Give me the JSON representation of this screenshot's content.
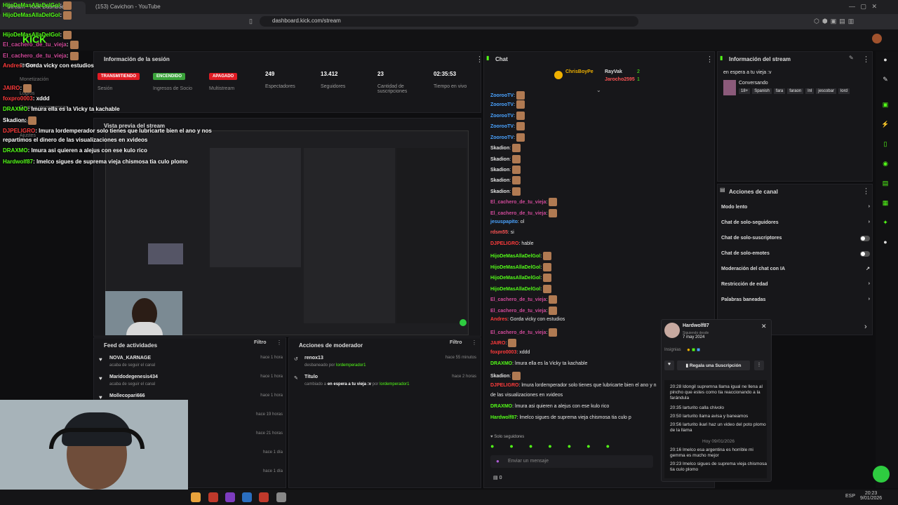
{
  "browser": {
    "tabs": [
      "Stream - Kick Dashboard",
      "(153) Cavichon - YouTube"
    ],
    "url": "dashboard.kick.com/stream"
  },
  "overlay_chat": [
    {
      "user": "HijoDeMasAllaDelGol",
      "text": ""
    },
    {
      "user": "HijoDeMasAllaDelGol",
      "text": ""
    },
    {
      "user": "El_cachero_de_tu_vieja",
      "text": ""
    },
    {
      "user": "El_cachero_de_tu_vieja",
      "text": ""
    },
    {
      "user": "Andres",
      "text": "Gorda vicky con estudios"
    },
    {
      "user": "JAIRO",
      "text": ""
    },
    {
      "user": "foxpro0003",
      "text": "xddd"
    },
    {
      "user": "DRAXMO",
      "text": "lmura ella es la Vicky ta kachable"
    },
    {
      "user": "Skadion",
      "text": ""
    },
    {
      "user": "DJPELIGRO",
      "text": "lmura lordemperador solo tienes que lubricarte bien el ano y nos"
    },
    {
      "user": "",
      "text": "repartimos el dinero de las visualizaciones en xvideos"
    },
    {
      "user": "DRAXMO",
      "text": "lmura asi quieren a alejus con ese kulo rico"
    },
    {
      "user": "Hardwolf87",
      "text": "lmelco sigues de suprema vieja chismosa tia culo plomo"
    }
  ],
  "left_nav": [
    "Stream",
    "Monetización",
    "Logros",
    "Grupo y recompensas",
    "Estudio",
    "Ajustes"
  ],
  "session": {
    "title": "Información de la sesión",
    "badges": [
      {
        "label": "TRANSMITIENDO",
        "color": "#e01b24",
        "caption": "Sesión"
      },
      {
        "label": "ENCENDIDO",
        "color": "#3aa33a",
        "caption": "Ingresos de Socio"
      },
      {
        "label": "APAGADO",
        "color": "#e01b24",
        "caption": "Multistream"
      }
    ],
    "stats": [
      {
        "value": "249",
        "label": "Espectadores"
      },
      {
        "value": "13.412",
        "label": "Seguidores"
      },
      {
        "value": "23",
        "label": "Cantidad de suscripciones"
      },
      {
        "value": "02:35:53",
        "label": "Tiempo en vivo"
      }
    ]
  },
  "preview": {
    "title": "Vista previa del stream"
  },
  "activity_feed": {
    "title": "Feed de actividades",
    "filter": "Filtro",
    "items": [
      {
        "name": "NOVA_KARNAGE",
        "sub": "acaba de seguir el canal",
        "time": "hace 1 hora"
      },
      {
        "name": "Maridodegenesis434",
        "sub": "acaba de seguir el canal",
        "time": "hace 1 hora"
      },
      {
        "name": "Mollecopari666",
        "sub": "",
        "time": "hace 1 hora"
      },
      {
        "name": "",
        "sub": "",
        "time": "hace 19 horas"
      },
      {
        "name": "",
        "sub": "",
        "time": "hace 21 horas"
      },
      {
        "name": "",
        "sub": "",
        "time": "hace 1 día"
      },
      {
        "name": "",
        "sub": "",
        "time": "hace 1 día"
      }
    ]
  },
  "mod_actions": {
    "title": "Acciones de moderador",
    "filter": "Filtro",
    "items": [
      {
        "name": "renox13",
        "sub1": "desbaneado por ",
        "mod": "lordemperador1",
        "time": "hace 55 minutos"
      },
      {
        "name": "Título",
        "sub1": "cambiado a ",
        "extra": "en espera a tu vieja :v",
        "sub2": " por ",
        "mod": "lordemperador1",
        "time": "hace 2 horas"
      }
    ]
  },
  "chat": {
    "title": "Chat",
    "top_users": [
      "ChrisBoyPe",
      "RayVak",
      "Jarocho2595"
    ],
    "top_counts": [
      "2",
      "1"
    ],
    "messages": [
      {
        "user": "ZoorooTV",
        "text": "",
        "color": "#4aa3ff"
      },
      {
        "user": "ZoorooTV",
        "text": "",
        "color": "#4aa3ff"
      },
      {
        "user": "ZoorooTV",
        "text": "",
        "color": "#4aa3ff"
      },
      {
        "user": "ZoorooTV",
        "text": "",
        "color": "#4aa3ff"
      },
      {
        "user": "ZoorooTV",
        "text": "",
        "color": "#4aa3ff"
      },
      {
        "user": "Skadion",
        "text": "",
        "color": "#e0e0e0"
      },
      {
        "user": "Skadion",
        "text": "",
        "color": "#e0e0e0"
      },
      {
        "user": "Skadion",
        "text": "",
        "color": "#e0e0e0"
      },
      {
        "user": "Skadion",
        "text": "",
        "color": "#e0e0e0"
      },
      {
        "user": "Skadion",
        "text": "",
        "color": "#e0e0e0"
      },
      {
        "user": "El_cachero_de_tu_vieja",
        "text": "",
        "color": "#d04a9a"
      },
      {
        "user": "El_cachero_de_tu_vieja",
        "text": "",
        "color": "#d04a9a"
      },
      {
        "user": "jesuspapito",
        "text": "ol",
        "color": "#4aa3ff"
      },
      {
        "user": "rdsm55",
        "text": "si",
        "color": "#ff5555"
      },
      {
        "user": "DJPELIGRO",
        "text": "hable",
        "color": "#ff3b3b"
      },
      {
        "user": "HijoDeMasAllaDelGol",
        "text": "",
        "color": "#53fc18"
      },
      {
        "user": "HijoDeMasAllaDelGol",
        "text": "",
        "color": "#53fc18"
      },
      {
        "user": "HijoDeMasAllaDelGol",
        "text": "",
        "color": "#53fc18"
      },
      {
        "user": "HijoDeMasAllaDelGol",
        "text": "",
        "color": "#53fc18"
      },
      {
        "user": "El_cachero_de_tu_vieja",
        "text": "",
        "color": "#d04a9a"
      },
      {
        "user": "El_cachero_de_tu_vieja",
        "text": "",
        "color": "#d04a9a"
      },
      {
        "user": "Andres",
        "text": "Gorda vicky con estudios",
        "color": "#ff3b3b"
      },
      {
        "user": "El_cachero_de_tu_vieja",
        "text": "",
        "color": "#d04a9a"
      },
      {
        "user": "JAIRO",
        "text": "",
        "color": "#ff3b3b"
      },
      {
        "user": "foxpro0003",
        "text": "xddd",
        "color": "#ff3b3b"
      },
      {
        "user": "DRAXMO",
        "text": "lmura ella es la Vicky ta kachable",
        "color": "#53fc18"
      },
      {
        "user": "Skadion",
        "text": "",
        "color": "#e0e0e0"
      },
      {
        "user": "DJPELIGRO",
        "text": "lmura lordemperador solo tienes que lubricarte bien el ano y n",
        "color": "#ff3b3b"
      },
      {
        "user": "",
        "text": "de las visualizaciones en xvideos",
        "color": "#e0e0e0"
      },
      {
        "user": "DRAXMO",
        "text": "lmura asi quieren a alejus con ese kulo rico",
        "color": "#53fc18"
      },
      {
        "user": "Hardwolf87",
        "text": "lmelco sigues de suprema vieja chismosa tia culo p",
        "color": "#53fc18"
      }
    ],
    "followers_only": "Solo seguidores",
    "input_placeholder": "Enviar un mensaje",
    "count": "0"
  },
  "stream_info": {
    "title": "Información del stream",
    "stream_title": "en espera a tu vieja :v",
    "category": "Conversando",
    "tags": [
      "18+",
      "Spanish",
      "fara",
      "faraon",
      "lnl",
      "jescobar",
      "lord"
    ]
  },
  "channel_actions": {
    "title": "Acciones de canal",
    "items": [
      {
        "label": "Modo lento",
        "type": "arrow"
      },
      {
        "label": "Chat de solo-seguidores",
        "type": "arrow"
      },
      {
        "label": "Chat de solo-suscriptores",
        "type": "toggle"
      },
      {
        "label": "Chat de solo-emotes",
        "type": "toggle"
      },
      {
        "label": "Moderación del chat con IA",
        "type": "link"
      },
      {
        "label": "Restricción de edad",
        "type": "arrow"
      },
      {
        "label": "Palabras baneadas",
        "type": "arrow"
      }
    ]
  },
  "user_card": {
    "username": "Hardwolf87",
    "follow_label": "Siguiendo desde",
    "follow_date": "7 may 2024",
    "badges_label": "Insignias",
    "gift_button": "Regala una Suscripción",
    "messages": [
      "20:28 ldongil supremna llama igual ne llena al pincho que estes como tia reaccionando a la farándula",
      "20:35 larturito calla chivolo",
      "20:50 larturito llama avisa y baneamos",
      "20:56 larturito ikari haz un video del poto plomo de la llama",
      "Hoy 09/01/2026",
      "20:16 lmelco esa argentina es horrible mi gemma es mucho mejor",
      "20:23 lmelco sigues de suprema vieja chismosa tia culo plomo"
    ]
  },
  "taskbar": {
    "lang": "ESP",
    "time": "20:23",
    "date": "9/01/2026"
  },
  "colors": {
    "accent": "#53fc18",
    "bg": "#0e0e10",
    "panel": "#17171a"
  },
  "icons": [
    "search-icon",
    "gear-icon",
    "heart-icon",
    "chevron-right-icon",
    "more-icon",
    "edit-icon"
  ]
}
